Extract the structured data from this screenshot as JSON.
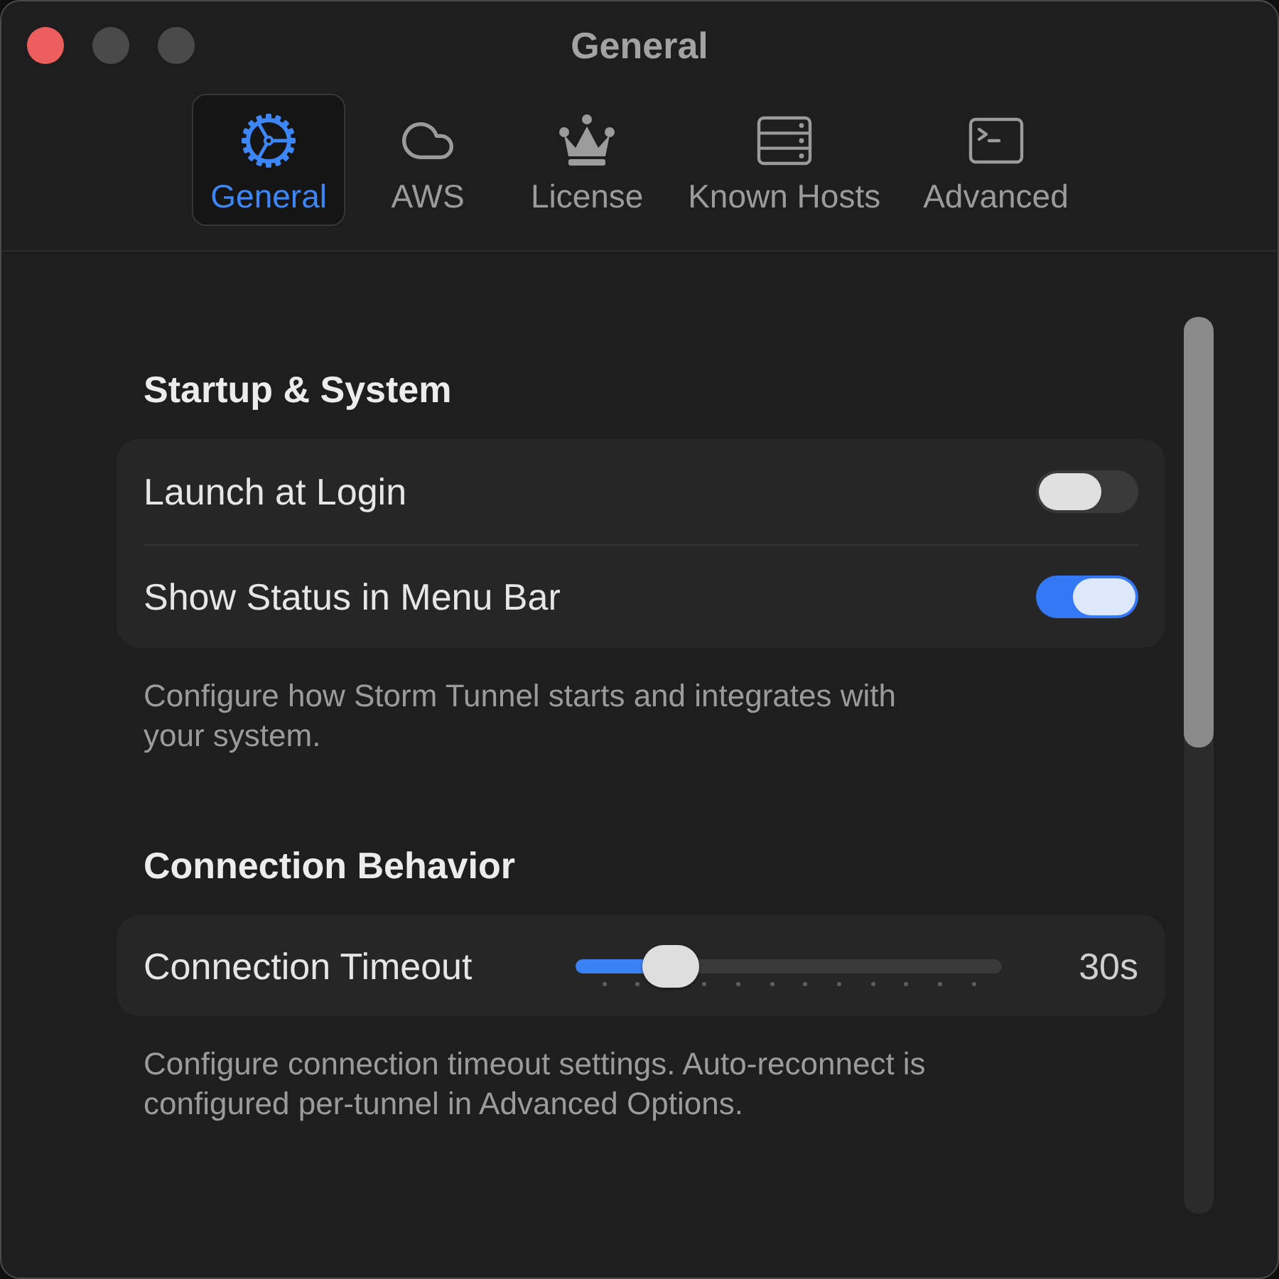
{
  "window": {
    "title": "General",
    "controls": [
      {
        "kind": "close",
        "disabled": false
      },
      {
        "kind": "minimize",
        "disabled": true
      },
      {
        "kind": "zoom",
        "disabled": true
      }
    ]
  },
  "tabs": [
    {
      "label": "General",
      "kind": "gear",
      "selected": true
    },
    {
      "label": "AWS",
      "kind": "cloud",
      "selected": false
    },
    {
      "label": "License",
      "kind": "crown",
      "selected": false
    },
    {
      "label": "Known Hosts",
      "kind": "servers",
      "selected": false
    },
    {
      "label": "Advanced",
      "kind": "terminal",
      "selected": false
    }
  ],
  "sections": [
    {
      "heading": "Startup & System",
      "rows": [
        {
          "kind": "toggle",
          "label": "Launch at Login",
          "on": false
        },
        {
          "kind": "toggle",
          "label": "Show Status in Menu Bar",
          "on": true
        }
      ],
      "description": "Configure how Storm Tunnel starts and integrates with your system."
    },
    {
      "heading": "Connection Behavior",
      "rows": [
        {
          "kind": "slider",
          "label": "Connection Timeout",
          "level": 0.18,
          "reading": "30s"
        }
      ],
      "description": "Configure connection timeout settings. Auto-reconnect is configured per-tunnel in Advanced Options."
    }
  ]
}
